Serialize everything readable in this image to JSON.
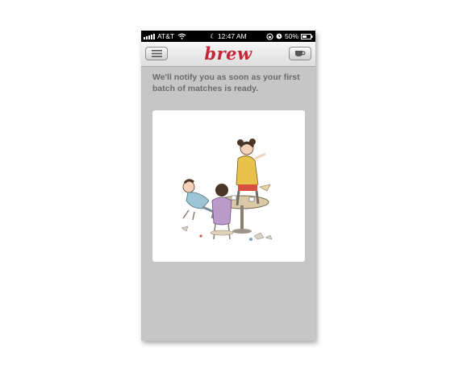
{
  "status_bar": {
    "carrier": "AT&T",
    "time": "12:47 AM",
    "battery": "50%"
  },
  "nav_bar": {
    "logo": "brew"
  },
  "message": "We'll notify you as soon as your first batch of matches is ready.",
  "colors": {
    "brand": "#c4263a",
    "background": "#c6c6c6",
    "text": "#6b6b6b"
  },
  "icons": {
    "menu": "menu-icon",
    "cup": "coffee-cup-icon"
  }
}
